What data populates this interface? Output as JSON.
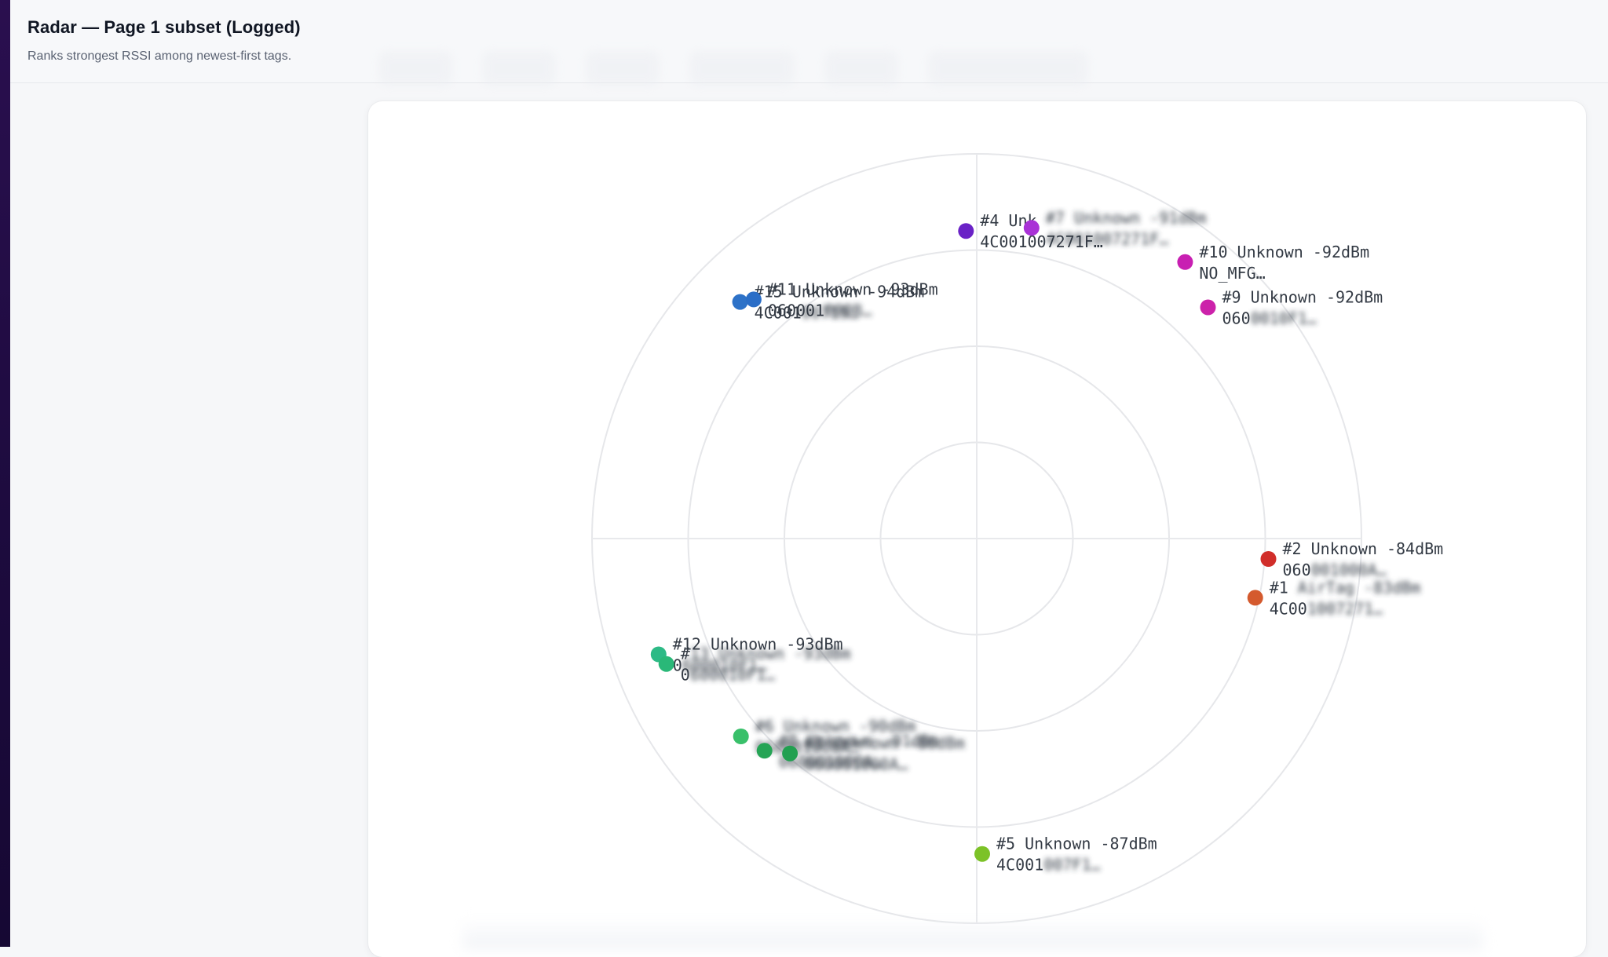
{
  "header": {
    "title": "Radar — Page 1 subset (Logged)",
    "subtitle": "Ranks strongest RSSI among newest-first tags."
  },
  "radar": {
    "rings": 4,
    "tags": [
      {
        "rank": "#4",
        "line1": "#4 Unk",
        "line2": "4C001007271F…",
        "color": "#6a22c6",
        "angle": -92,
        "r": 0.8
      },
      {
        "rank": "#7",
        "line1": "#7 Unknown -91dBm",
        "line2": "4C001007271F…",
        "color": "#a932d6",
        "angle": -80,
        "r": 0.82
      },
      {
        "rank": "#10",
        "line1": "#10 Unknown -92dBm",
        "line2": "NO_MFG…",
        "color": "#c81fb2",
        "angle": -53,
        "r": 0.9
      },
      {
        "rank": "#9",
        "line1": "#9 Unknown -92dBm",
        "line2": "0600010F1…",
        "color": "#cc22aa",
        "angle": -45,
        "r": 0.85
      },
      {
        "rank": "#15",
        "line1": "#15 Unknown -94dBm",
        "line2": "4C00100719…",
        "color": "#2d72c8",
        "angle": -135,
        "r": 0.87
      },
      {
        "rank": "#11",
        "line1": "#11 Unknown -93dBm",
        "line2": "060001000B…",
        "color": "#2a6ec7",
        "angle": -133,
        "r": 0.85
      },
      {
        "rank": "#2",
        "line1": "#2 Unknown -84dBm",
        "line2": "060001000A…",
        "color": "#d12e2a",
        "angle": 4,
        "r": 0.76
      },
      {
        "rank": "#1",
        "line1": "#1 AirTag -83dBm",
        "line2": "4C001007271…",
        "color": "#d45a2e",
        "angle": 12,
        "r": 0.74
      },
      {
        "rank": "#12",
        "line1": "#12 Unknown -93dBm",
        "line2": "0600010F1…",
        "color": "#2dba86",
        "angle": 160,
        "r": 0.88
      },
      {
        "rank": "#13",
        "line1": "#13 Unknown -93dBm",
        "line2": "0600010F1…",
        "color": "#2ab878",
        "angle": 158,
        "r": 0.87
      },
      {
        "rank": "#6",
        "line1": "#6 Unknown -90dBm",
        "line2": "060001000A…",
        "color": "#39c06a",
        "angle": 140,
        "r": 0.8
      },
      {
        "rank": "#8",
        "line1": "#8 Unknown -91dBm",
        "line2": "060001000A…",
        "color": "#25a455",
        "angle": 135,
        "r": 0.78
      },
      {
        "rank": "#3",
        "line1": "#3 Unknown -86dBm",
        "line2": "060001000A…",
        "color": "#21a050",
        "angle": 131,
        "r": 0.74
      },
      {
        "rank": "#5",
        "line1": "#5 Unknown -87dBm",
        "line2": "4C001007F1…",
        "color": "#7cc227",
        "angle": 89,
        "r": 0.82
      }
    ]
  },
  "toolbar": {
    "pills": [
      "",
      "",
      "",
      "",
      "",
      ""
    ]
  }
}
